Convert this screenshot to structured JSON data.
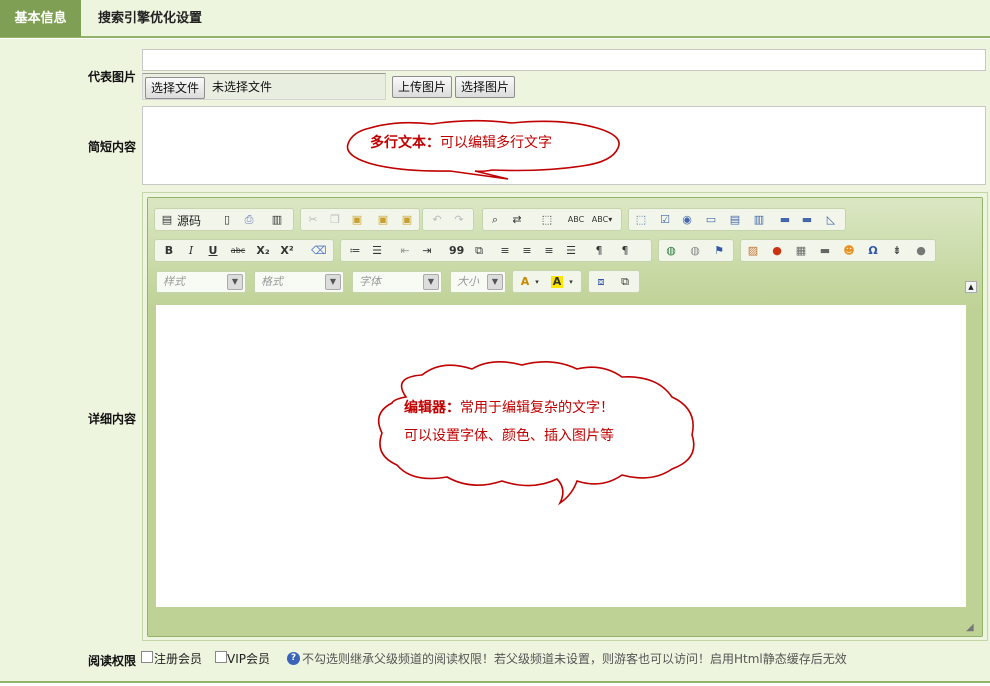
{
  "tabs": {
    "basic": "基本信息",
    "seo": "搜索引擎优化设置"
  },
  "fields": {
    "image_label": "代表图片",
    "summary_label": "简短内容",
    "detail_label": "详细内容",
    "permission_label": "阅读权限"
  },
  "image_field": {
    "url_value": "",
    "choose_file_btn": "选择文件",
    "no_file_text": "未选择文件",
    "upload_btn": "上传图片",
    "select_btn": "选择图片"
  },
  "summary_annotation": {
    "bold": "多行文本：",
    "text": "可以编辑多行文字"
  },
  "editor": {
    "source_label": "源码",
    "style_combo": "样式",
    "format_combo": "格式",
    "font_combo": "字体",
    "size_combo": "大小",
    "annotation_bold": "编辑器：",
    "annotation_text": "常用于编辑复杂的文字！",
    "annotation_line2": "可以设置字体、颜色、插入图片等",
    "toolbar_glyphs": {
      "bold": "B",
      "italic": "I",
      "underline": "U",
      "strike": "abc",
      "subscript": "X₂",
      "superscript": "X²",
      "text_color": "A",
      "bg_color": "A",
      "link": "🌐",
      "special_char": "Ω",
      "quote": "99"
    }
  },
  "permissions": {
    "registered": "注册会员",
    "vip": "VIP会员",
    "note": "不勾选则继承父级频道的阅读权限！若父级频道未设置，则游客也可以访问！启用Html静态缓存后无效"
  },
  "colors": {
    "accent": "#7f9f55",
    "panel": "#eef5df",
    "editor_bar": "#bfd296",
    "annotation_red": "#c00000"
  }
}
